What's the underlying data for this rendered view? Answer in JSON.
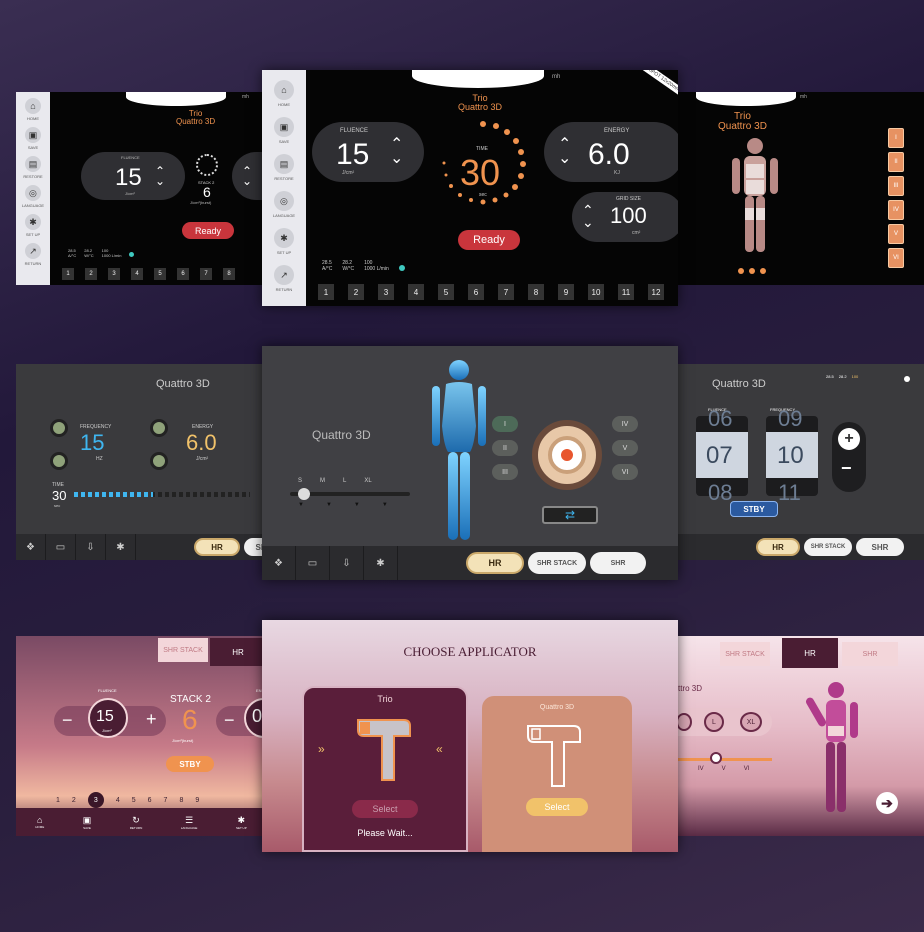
{
  "s1": {
    "sidebar": [
      "HOME",
      "SAVE",
      "RESTORE",
      "LANGUAGE",
      "SET UP",
      "RETURN"
    ],
    "model_line1": "Trio",
    "model_line2": "Quattro 3D",
    "fluence_label": "FLUENCE",
    "fluence_value": "15",
    "fluence_unit": "J/cm²",
    "stack_label": "STACK 2",
    "stack_value": "6",
    "stack_unit": "J/cm²(burst)",
    "ready": "Ready",
    "temp1": "28.5",
    "temp1_unit": "A/°C",
    "temp2": "28.2",
    "temp2_unit": "W/°C",
    "flow": "100",
    "flow_unit": "1000 L/min",
    "numbers": [
      "1",
      "2",
      "3",
      "4",
      "5",
      "6",
      "7",
      "8"
    ],
    "corner": "mh"
  },
  "s2": {
    "sidebar": [
      "HOME",
      "SAVE",
      "RESTORE",
      "LANGUAGE",
      "SET UP",
      "RETURN"
    ],
    "corner_tag": "SPOT 12x20mm",
    "model_line1": "Trio",
    "model_line2": "Quattro 3D",
    "fluence_label": "FLUENCE",
    "fluence_value": "15",
    "fluence_unit": "J/cm²",
    "time_label": "TIME",
    "time_value": "30",
    "time_unit": "sec",
    "energy_label": "ENERGY",
    "energy_value": "6.0",
    "energy_unit": "KJ",
    "grid_label": "GRID SIZE",
    "grid_value": "100",
    "grid_unit": "cm²",
    "ready": "Ready",
    "temp1": "28.5",
    "temp1_unit": "A/°C",
    "temp2": "28.2",
    "temp2_unit": "W/°C",
    "flow": "100",
    "flow_unit": "1000 L/min",
    "numbers": [
      "1",
      "2",
      "3",
      "4",
      "5",
      "6",
      "7",
      "8",
      "9",
      "10",
      "11",
      "12"
    ],
    "corner": "mh"
  },
  "s3": {
    "model_line1": "Trio",
    "model_line2": "Quattro 3D",
    "skin_types": [
      "I",
      "II",
      "III",
      "IV",
      "V",
      "VI"
    ],
    "corner": "mh"
  },
  "s4": {
    "title": "Quattro 3D",
    "frequency_label": "FREQUENCY",
    "frequency_value": "15",
    "frequency_unit": "HZ",
    "energy_label": "ENERGY",
    "energy_value": "6.0",
    "energy_unit": "J/cm²",
    "time_label": "TIME",
    "time_value": "30",
    "time_unit": "sec",
    "progress": 0.45,
    "hr": "HR",
    "shr": "SHR"
  },
  "s5": {
    "title": "Quattro 3D",
    "sizes": [
      "S",
      "M",
      "L",
      "XL"
    ],
    "skin_left": [
      "I",
      "II",
      "III"
    ],
    "skin_right": [
      "IV",
      "V",
      "VI"
    ],
    "hr": "HR",
    "shr_stack": "SHR STACK",
    "shr": "SHR"
  },
  "s6": {
    "title": "Quattro 3D",
    "temp1": "28.5",
    "temp2": "28.2",
    "flow": "100",
    "fluence_label": "FLUENCE",
    "fluence_value": "07",
    "frequency_label": "FREQUENCY",
    "frequency_value": "10",
    "prev_fluence": "06",
    "prev_frequency": "09",
    "next_fluence": "08",
    "next_frequency": "11",
    "stby": "STBY",
    "hr": "HR",
    "shr_stack": "SHR STACK",
    "shr": "SHR"
  },
  "s7": {
    "tab_shr_stack": "SHR STACK",
    "tab_hr": "HR",
    "fluence_label": "FLUENCE",
    "fluence_value": "15",
    "fluence_unit": "J/cm²",
    "stack_label": "STACK 2",
    "stack_value": "6",
    "stack_unit": "J/cm²(burst)",
    "energy_label": "EN",
    "energy_value": "0",
    "stby": "STBY",
    "numbers": [
      "1",
      "2",
      "3",
      "4",
      "5",
      "6",
      "7",
      "8",
      "9"
    ],
    "active_number": "3",
    "bottom": [
      "HOME",
      "SAVE",
      "RETURN",
      "LANGUAGE",
      "SET UP"
    ]
  },
  "s8": {
    "title": "CHOOSE APPLICATOR",
    "left_name": "Trio",
    "left_select": "Select",
    "left_status": "Please Wait...",
    "right_name": "Quattro 3D",
    "right_select": "Select"
  },
  "s9": {
    "tab_shr_stack": "SHR STACK",
    "tab_hr": "HR",
    "tab_shr": "SHR",
    "title": "ttro 3D",
    "sizes": [
      "L",
      "XL"
    ],
    "skin_labels": [
      "IV",
      "V",
      "VI"
    ]
  },
  "colors": {
    "ready": "#c9353c",
    "accent_orange": "#f0934f",
    "accent_blue": "#3fb6f0",
    "accent_yellow": "#f1c26a"
  }
}
